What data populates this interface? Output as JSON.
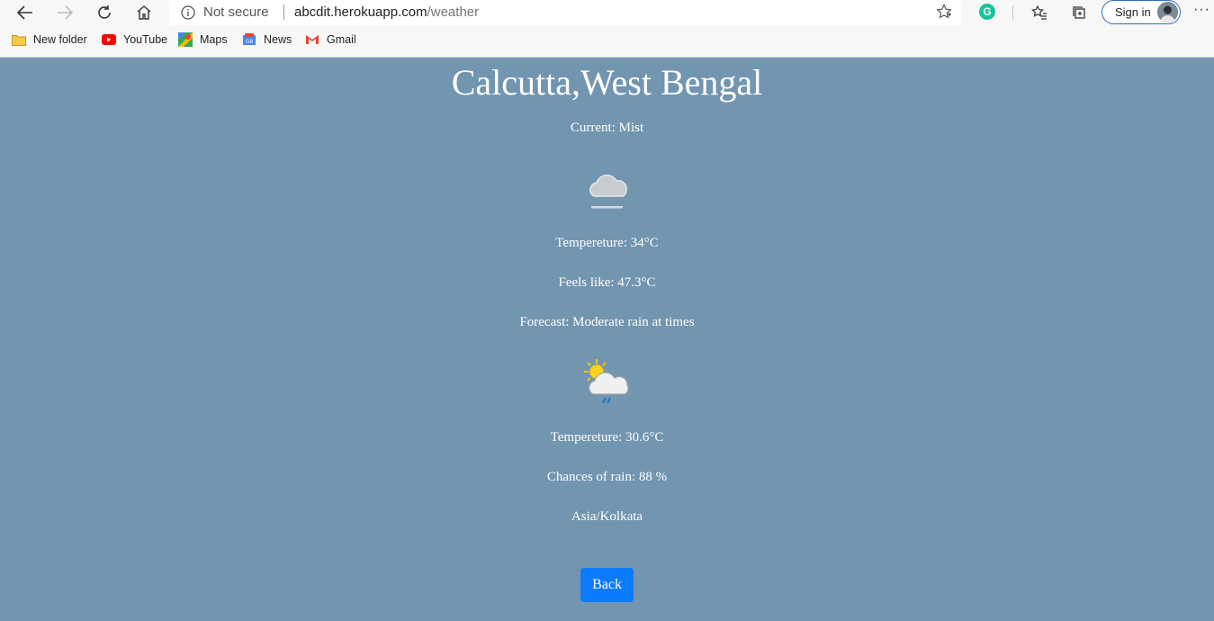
{
  "browser": {
    "address": {
      "security_label": "Not secure",
      "url_host": "abcdit.herokuapp.com",
      "url_path": "/weather"
    },
    "sign_in_label": "Sign in",
    "more_label": "···",
    "bookmarks": [
      {
        "label": "New folder",
        "icon": "folder-icon"
      },
      {
        "label": "YouTube",
        "icon": "youtube-icon"
      },
      {
        "label": "Maps",
        "icon": "maps-icon"
      },
      {
        "label": "News",
        "icon": "news-icon"
      },
      {
        "label": "Gmail",
        "icon": "gmail-icon"
      }
    ]
  },
  "weather": {
    "location": "Calcutta,West Bengal",
    "current_condition": "Current: Mist",
    "current_icon": "mist-icon",
    "temperature": "Tempereture: 34°C",
    "feels_like": "Feels like: 47.3°C",
    "forecast": "Forecast: Moderate rain at times",
    "forecast_icon": "sun-cloud-rain-icon",
    "forecast_temperature": "Tempereture: 30.6°C",
    "chance_of_rain": "Chances of rain: 88 %",
    "timezone": "Asia/Kolkata",
    "back_label": "Back"
  },
  "colors": {
    "page_background": "#7295b0",
    "back_button": "#0d7bfe"
  }
}
